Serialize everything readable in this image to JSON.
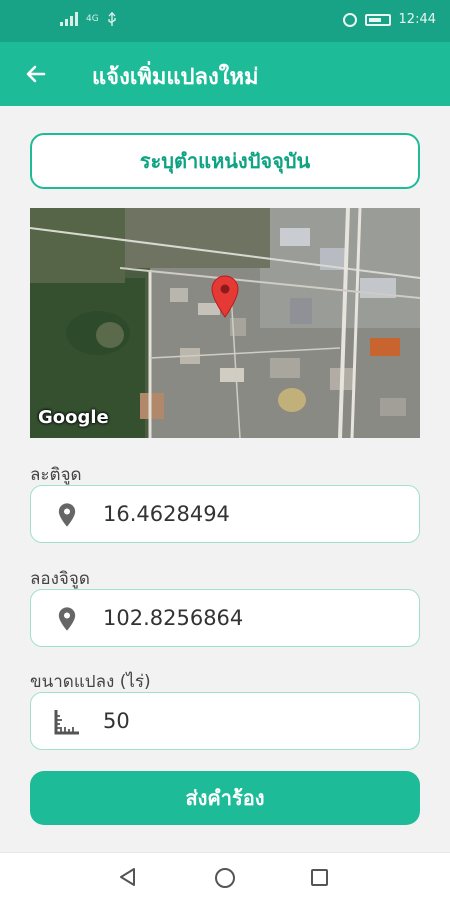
{
  "status_bar": {
    "network_label": "4G",
    "time": "12:44"
  },
  "header": {
    "title": "แจ้งเพิ่มแปลงใหม่",
    "back_icon": "arrow-left-icon"
  },
  "locate_button": {
    "label": "ระบุตำแหน่งปัจจุบัน"
  },
  "map": {
    "attribution": "Google",
    "marker_icon": "map-pin-icon"
  },
  "fields": {
    "latitude": {
      "label": "ละติจูด",
      "value": "16.4628494",
      "icon": "location-pin-icon"
    },
    "longitude": {
      "label": "ลองจิจูด",
      "value": "102.8256864",
      "icon": "location-pin-icon"
    },
    "plot_size": {
      "label": "ขนาดแปลง (ไร่)",
      "value": "50",
      "icon": "ruler-icon"
    }
  },
  "submit_button": {
    "label": "ส่งคำร้อง"
  },
  "colors": {
    "status_bar": "#18a386",
    "primary": "#1ebb98",
    "accent_text": "#0ea382",
    "marker": "#e53935"
  }
}
